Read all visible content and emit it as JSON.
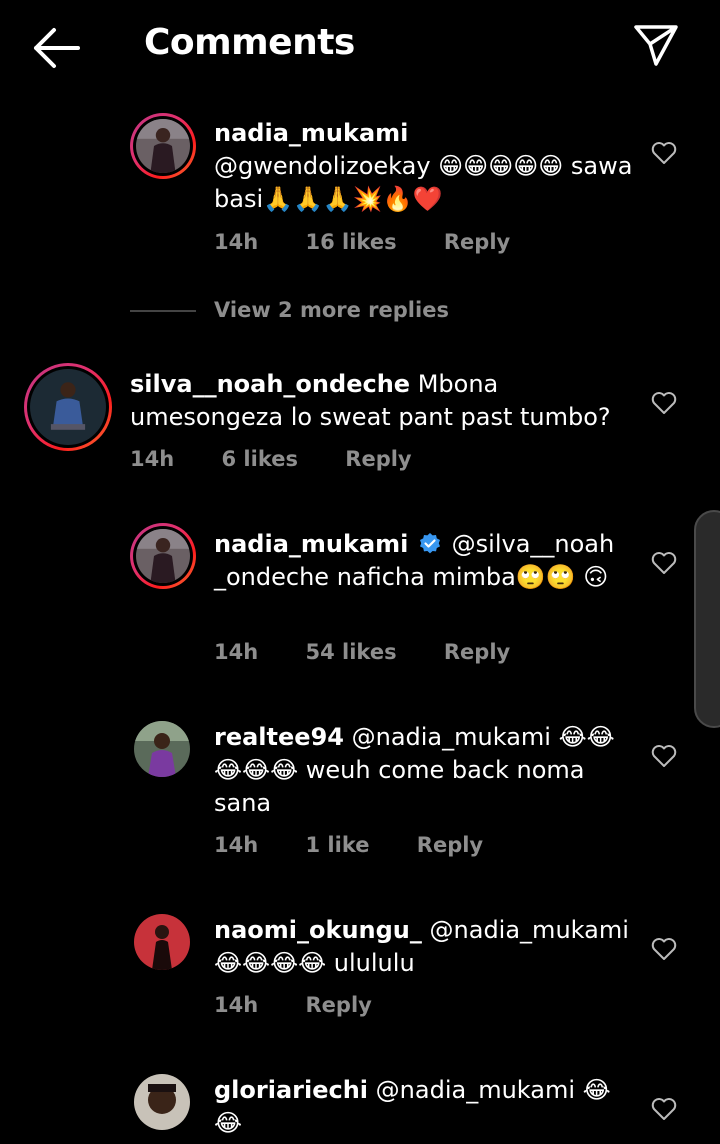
{
  "header": {
    "title": "Comments"
  },
  "view_more": "View 2 more replies",
  "comments": [
    {
      "username": "nadia_mukami",
      "text": "@gwendolizoekay 😁😁😁😁😁 sawa basi🙏🙏🙏💥🔥❤️",
      "time": "14h",
      "likes": "16 likes",
      "reply": "Reply"
    },
    {
      "username": "silva__noah_ondeche",
      "text": "Mbona umesongeza lo sweat pant past tumbo?",
      "time": "14h",
      "likes": "6 likes",
      "reply": "Reply"
    },
    {
      "username": "nadia_mukami",
      "text": "@silva__noah _ondeche naficha mimba🙄🙄 🙃",
      "time": "14h",
      "likes": "54 likes",
      "reply": "Reply"
    },
    {
      "username": "realtee94",
      "text": "@nadia_mukami 😂😂 😂😂😂 weuh come back noma sana",
      "time": "14h",
      "likes": "1 like",
      "reply": "Reply"
    },
    {
      "username": "naomi_okungu_",
      "text": "@nadia_mukami 😂😂😂😂 ulululu",
      "time": "14h",
      "likes": "",
      "reply": "Reply"
    },
    {
      "username": "gloriariechi",
      "text": "@nadia_mukami 😂 😂",
      "time": "",
      "likes": "",
      "reply": ""
    }
  ],
  "icons": {
    "back": "back-arrow-icon",
    "send": "paper-plane-icon",
    "like": "heart-outline-icon",
    "verified": "verified-badge-icon"
  },
  "colors": {
    "background": "#000000",
    "secondary_text": "#8e8e8e",
    "verified": "#3897f0"
  }
}
